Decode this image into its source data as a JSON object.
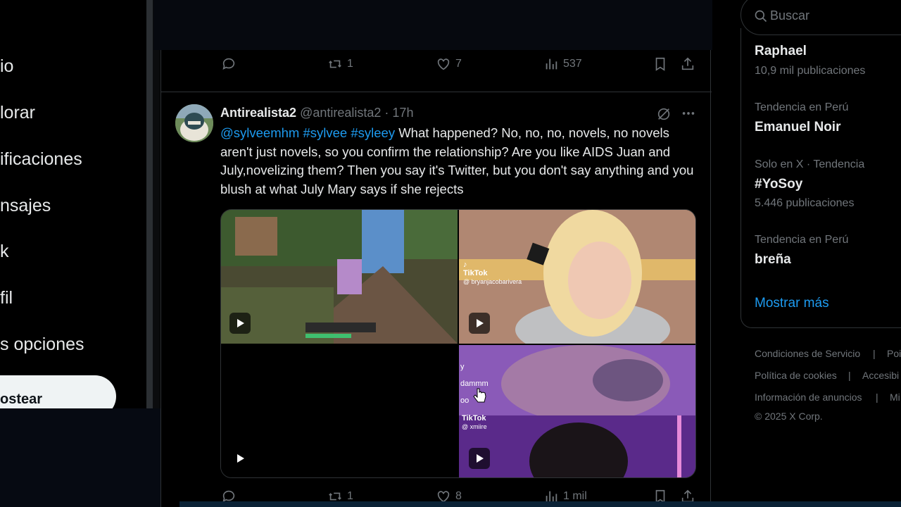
{
  "nav": {
    "items": [
      "io",
      "lorar",
      "ificaciones",
      "nsajes",
      "k",
      "fil",
      "s opciones"
    ],
    "post_label": "ostear"
  },
  "prev_tweet": {
    "retweets": "1",
    "likes": "7",
    "views": "537"
  },
  "tweet": {
    "name": "Antirealista2",
    "handle": "@antirealista2",
    "time": "· 17h",
    "mentions": [
      "@sylveemhm",
      "#sylvee",
      "#syleey"
    ],
    "text": "What happened? No, no, no, novels, no novels aren't just novels, so you confirm the relationship? Are you like AIDS Juan and July,novelizing them?  Then you say it's Twitter, but you don't say anything and you blush at what July Mary says if she rejects",
    "tiktok_1": "TikTok",
    "tiktok_1_user": "@ bryanjacobarivera",
    "tiktok_2": "TikTok",
    "tiktok_2_user": "@ xmiire",
    "overlay_1": "y",
    "overlay_2": "dammm",
    "overlay_3": "oo",
    "retweets": "1",
    "likes": "8",
    "views": "1 mil"
  },
  "right": {
    "search_placeholder": "Buscar",
    "trends": [
      {
        "meta": "",
        "title": "Raphael",
        "count": "10,9 mil publicaciones"
      },
      {
        "meta": "Tendencia en Perú",
        "title": "Emanuel Noir",
        "count": ""
      },
      {
        "meta": "Solo en X · Tendencia",
        "title": "#YoSoy",
        "count": "5.446 publicaciones"
      },
      {
        "meta": "Tendencia en Perú",
        "title": "breña",
        "count": ""
      }
    ],
    "show_more": "Mostrar más",
    "footer": [
      "Condiciones de Servicio",
      "Poi",
      "Política de cookies",
      "Accesibi",
      "Información de anuncios",
      "Mi"
    ],
    "footer_sep": "|",
    "copyright": "© 2025 X Corp."
  },
  "colors": {
    "accent": "#1d9bf0",
    "text": "#e7e9ea",
    "muted": "#71767b",
    "border": "#2f3336"
  }
}
